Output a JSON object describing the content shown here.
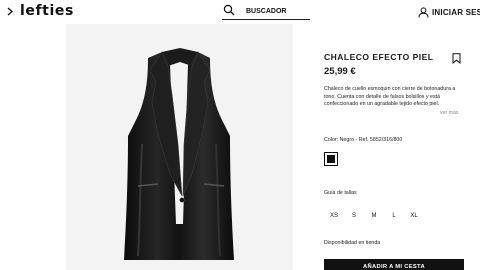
{
  "header": {
    "logo": "lefties",
    "search_placeholder": "BUSCADOR",
    "login_label": "INICIAR SESIÓN",
    "icons": [
      "menu-icon",
      "search-icon",
      "user-icon"
    ]
  },
  "product": {
    "title": "CHALECO EFECTO PIEL",
    "price": "25,99 €",
    "description": "Chaleco de cuello esmoquin con cierre de botonadura a tono. Cuenta con detalle de falsos bolsillos y está confeccionado en un agradable tejido efecto piel.",
    "more_label": "ver más",
    "color_label": "Color: Negro - Ref. 5852/316/800",
    "selected_color": "#111111",
    "size_guide_label": "Guía de tallas",
    "sizes": [
      "XS",
      "S",
      "M",
      "L",
      "XL"
    ],
    "availability_label": "Disponibilidad en tienda",
    "add_to_cart_label": "AÑADIR A MI CESTA"
  },
  "colors": {
    "accent": "#111111",
    "gallery_bg": "#f3f3f3"
  }
}
